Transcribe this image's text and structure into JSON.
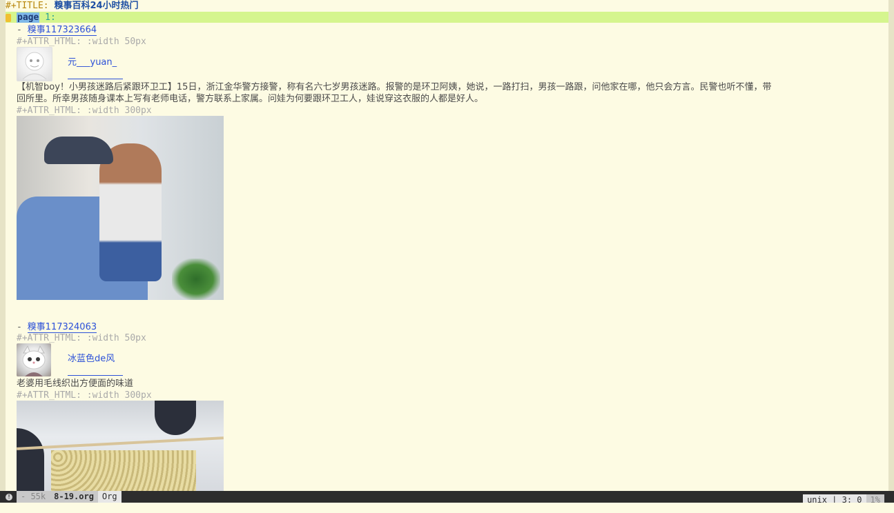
{
  "buffer": {
    "title_keyword": "#+TITLE:",
    "title": "糗事百科24小时热门",
    "page_heading_word": "page",
    "page_heading_rest": " 1:",
    "entries": [
      {
        "dash": "- ",
        "link_prefix": "糗事",
        "link_id": "117323664",
        "attr_avatar": "#+ATTR_HTML: :width 50px",
        "avatar_icon": "avatar-icon",
        "username": "元___yuan_",
        "content_line1": "【机智boy！小男孩迷路后紧跟环卫工】15日，浙江金华警方接警，称有名六七岁男孩迷路。报警的是环卫阿姨，她说，一路打扫，男孩一路跟，问他家在哪，他只会方言。民警也听不懂，带",
        "content_line2": "回所里。所幸男孩随身课本上写有老师电话，警方联系上家属。问娃为何要跟环卫工人，娃说穿这衣服的人都是好人。",
        "attr_image": "#+ATTR_HTML: :width 300px"
      },
      {
        "dash": "- ",
        "link_prefix": "糗事",
        "link_id": "117324063",
        "attr_avatar": "#+ATTR_HTML: :width 50px",
        "avatar_icon": "avatar-icon",
        "username": "冰蓝色de风",
        "content_line1": "老婆用毛线织出方便面的味道",
        "attr_image": "#+ATTR_HTML: :width 300px"
      }
    ]
  },
  "modeline": {
    "info_icon": "info-icon",
    "info_glyph": "!",
    "size": "- 55k",
    "buffer_name": "8-19.org",
    "major_mode": "Org",
    "encoding": "unix | 3: 0",
    "percent": "1%"
  }
}
